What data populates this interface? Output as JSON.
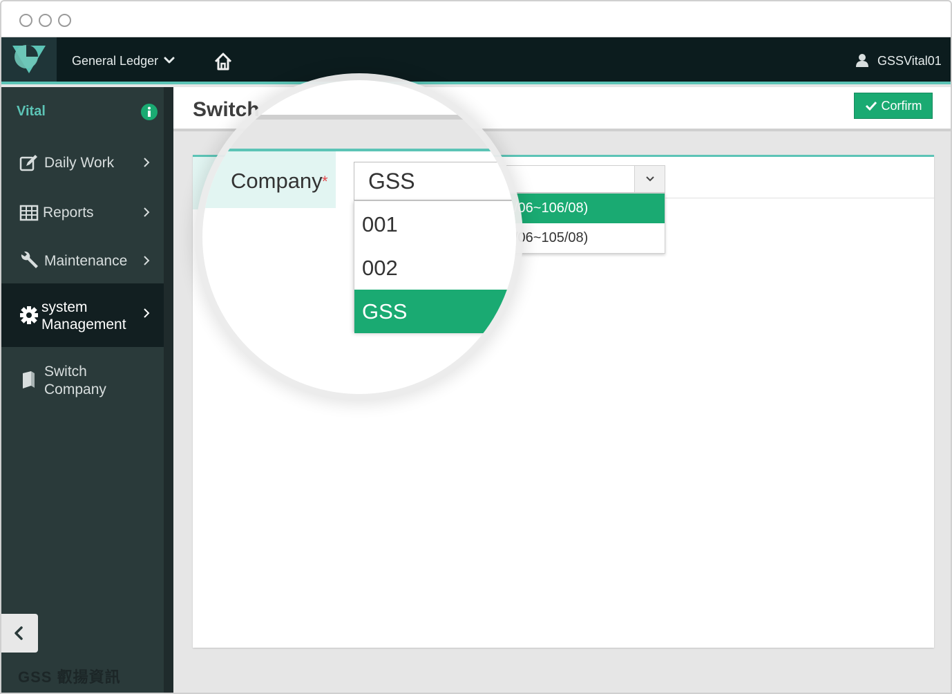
{
  "topnav": {
    "app_name": "General Ledger",
    "user_name": "GSSVital01"
  },
  "sidebar": {
    "brand": "Vital",
    "items": [
      {
        "label": "Daily Work",
        "icon": "edit-icon"
      },
      {
        "label": "Reports",
        "icon": "table-icon"
      },
      {
        "label": "Maintenance",
        "icon": "wrench-icon"
      },
      {
        "label_line1": "system",
        "label_line2": "Management",
        "icon": "gear-icon",
        "active": true
      },
      {
        "label_line1": "Switch",
        "label_line2": "Company",
        "icon": "book-icon"
      }
    ],
    "footer_logo": "GSS 叡揚資訊"
  },
  "page": {
    "title": "Switch",
    "confirm_label": "Corfirm",
    "form": {
      "company_label": "Company",
      "required_mark": "*",
      "company_value": "GSS",
      "company_options": [
        "001",
        "002",
        "GSS"
      ],
      "company_selected": "GSS",
      "period_options": [
        "/06~106/08)",
        "/06~105/08)"
      ],
      "period_selected": "/06~106/08)"
    }
  },
  "colors": {
    "accent": "#5cc4b6",
    "success": "#1aaa72",
    "nav_bg": "#0c1c1e",
    "sidebar_bg": "#2a3a3a"
  }
}
